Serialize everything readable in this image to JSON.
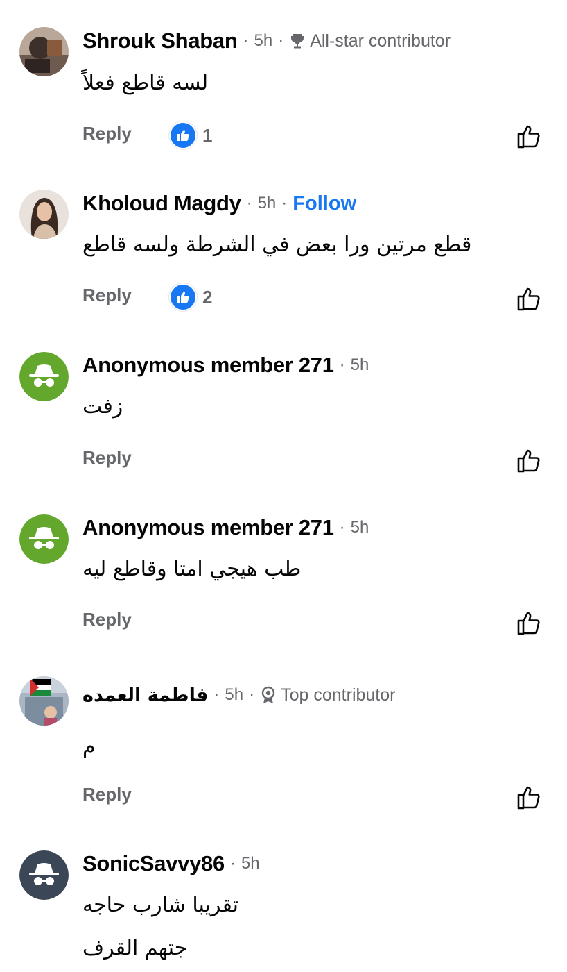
{
  "comments": [
    {
      "author": "Shrouk Shaban",
      "time": "5h",
      "badge": "All-star contributor",
      "badge_icon": "trophy-icon",
      "text_lines": [
        "لسه قاطع فعلاً"
      ],
      "reply_label": "Reply",
      "reaction_count": "1"
    },
    {
      "author": "Kholoud Magdy",
      "time": "5h",
      "follow_label": "Follow",
      "text_lines": [
        "قطع مرتين ورا بعض في الشرطة ولسه قاطع"
      ],
      "reply_label": "Reply",
      "reaction_count": "2"
    },
    {
      "author": "Anonymous member 271",
      "time": "5h",
      "text_lines": [
        "زفت"
      ],
      "reply_label": "Reply"
    },
    {
      "author": "Anonymous member 271",
      "time": "5h",
      "text_lines": [
        "طب هيجي امتا وقاطع ليه"
      ],
      "reply_label": "Reply"
    },
    {
      "author": "فاطمة العمده",
      "time": "5h",
      "badge": "Top contributor",
      "badge_icon": "rosette-icon",
      "text_lines": [
        "م"
      ],
      "reply_label": "Reply"
    },
    {
      "author": "SonicSavvy86",
      "time": "5h",
      "text_lines": [
        "تقريبا شارب حاجه",
        "جتهم القرف"
      ]
    }
  ],
  "separator": "·",
  "colors": {
    "accent": "#1877f2",
    "secondary_text": "#65676b",
    "anonymous_green": "#63a72d",
    "anonymous_dark": "#3b4757"
  }
}
